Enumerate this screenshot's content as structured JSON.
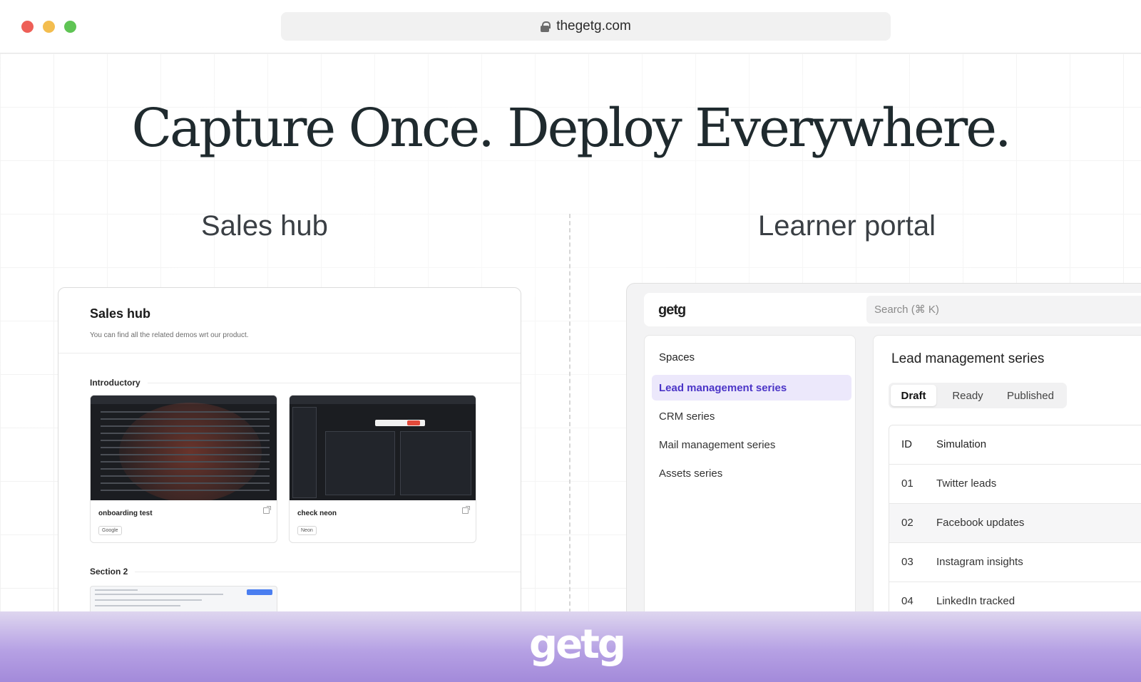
{
  "browser": {
    "url": "thegetg.com"
  },
  "hero": {
    "headline": "Capture Once. Deploy Everywhere."
  },
  "columns": {
    "left_label": "Sales hub",
    "right_label": "Learner portal"
  },
  "sales_hub": {
    "title": "Sales hub",
    "subtitle": "You can find all the related demos wrt our product.",
    "sections": [
      {
        "title": "Introductory",
        "demos": [
          {
            "name": "onboarding test",
            "tag": "Google"
          },
          {
            "name": "check neon",
            "tag": "Neon"
          }
        ]
      },
      {
        "title": "Section 2"
      }
    ]
  },
  "learner_portal": {
    "logo": "getg",
    "search_placeholder": "Search (⌘ K)",
    "spaces_heading": "Spaces",
    "spaces": [
      "Lead management series",
      "CRM series",
      "Mail management series",
      "Assets series"
    ],
    "active_space": "Lead management series",
    "series_title": "Lead management series",
    "tabs": [
      "Draft",
      "Ready",
      "Published"
    ],
    "active_tab": "Draft",
    "table": {
      "headers": [
        "ID",
        "Simulation"
      ],
      "rows": [
        {
          "id": "01",
          "simulation": "Twitter leads"
        },
        {
          "id": "02",
          "simulation": "Facebook updates"
        },
        {
          "id": "03",
          "simulation": "Instagram insights"
        },
        {
          "id": "04",
          "simulation": "LinkedIn tracked"
        }
      ]
    }
  },
  "footer": {
    "logo": "getg"
  },
  "colors": {
    "accent": "#4b35c7",
    "accent_bg": "#ece8fb",
    "footer_gradient_end": "#a38ada"
  }
}
